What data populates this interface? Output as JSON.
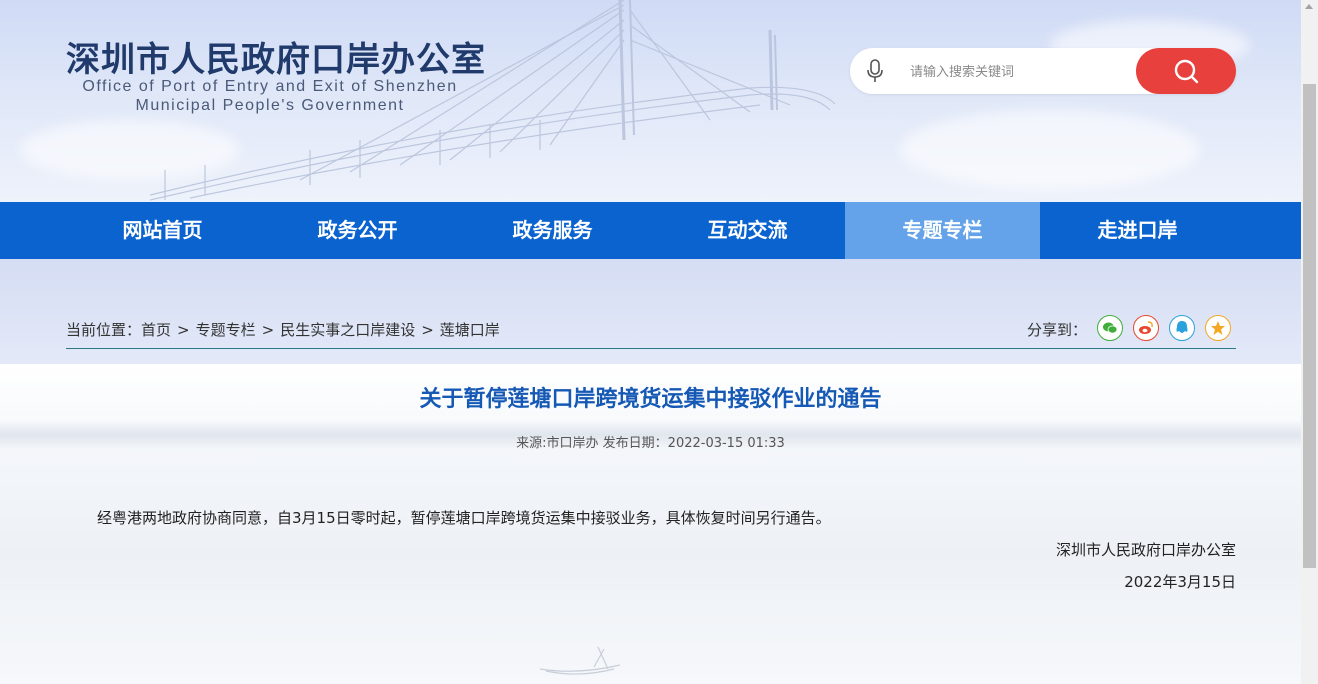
{
  "header": {
    "site_title": "深圳市人民政府口岸办公室",
    "subtitle_line1": "Office of Port of Entry and Exit of Shenzhen",
    "subtitle_line2": "Municipal People's Government"
  },
  "search": {
    "placeholder": "请输入搜索关键词",
    "value": ""
  },
  "nav": {
    "items": [
      {
        "label": "网站首页"
      },
      {
        "label": "政务公开"
      },
      {
        "label": "政务服务"
      },
      {
        "label": "互动交流"
      },
      {
        "label": "专题专栏"
      },
      {
        "label": "走进口岸"
      }
    ],
    "active_label": "专题专栏"
  },
  "breadcrumb": {
    "prefix": "当前位置：",
    "items": [
      "首页",
      "专题专栏",
      "民生实事之口岸建设",
      "莲塘口岸"
    ],
    "separator": ">"
  },
  "share": {
    "label": "分享到：",
    "icons": [
      "wechat-icon",
      "weibo-icon",
      "qq-icon",
      "favorite-icon"
    ],
    "colors": {
      "wechat": "#3fae3a",
      "weibo": "#e6472f",
      "qq": "#2aa2dc",
      "favorite": "#f5a623"
    }
  },
  "article": {
    "title": "关于暂停莲塘口岸跨境货运集中接驳作业的通告",
    "meta": "来源:市口岸办 发布日期：2022-03-15 01:33",
    "body": "经粤港两地政府协商同意，自3月15日零时起，暂停莲塘口岸跨境货运集中接驳业务，具体恢复时间另行通告。",
    "signature_org": "深圳市人民政府口岸办公室",
    "signature_date": "2022年3月15日"
  },
  "colors": {
    "nav_bg": "#0a63cf",
    "nav_active": "#64a3e9",
    "search_button": "#e8403c",
    "title": "#1559b5"
  }
}
